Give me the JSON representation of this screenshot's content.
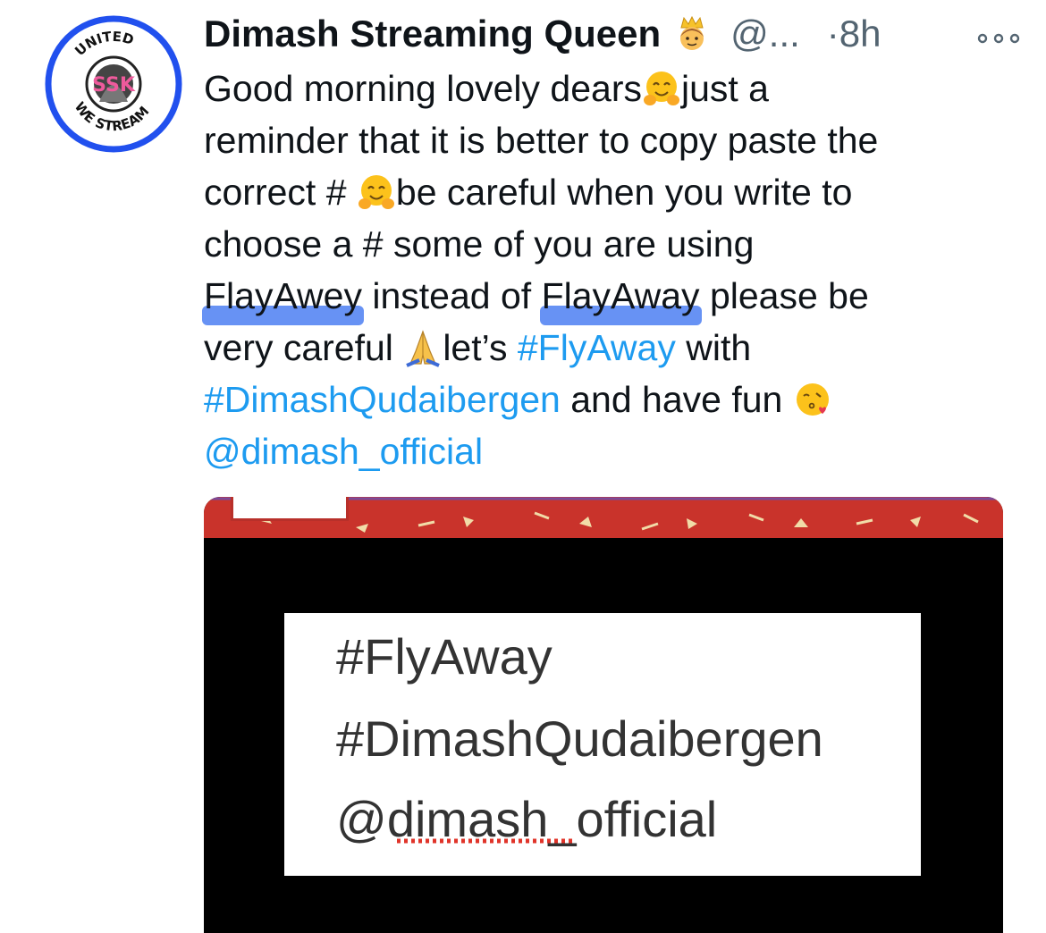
{
  "tweet": {
    "author": {
      "display_name": "Dimash Streaming Queen",
      "handle": "@...",
      "avatar_text_top": "UNITED",
      "avatar_text_center": "SSK",
      "avatar_text_bottom": "WE STREAM",
      "badge_icon": "crown-person-emoji"
    },
    "separator": "·",
    "time": "8h",
    "more_icon": "more-dots-icon",
    "text": {
      "l1_a": "Good morning lovely dears",
      "l1_b": "just a",
      "l2": "reminder that it is better to copy paste the",
      "l3_a": "correct # ",
      "l3_b": "be careful when you write to",
      "l4": "choose a #  some of you are using",
      "l5_a": "FlayAwey",
      "l5_b": " instead of ",
      "l5_c": "FlayAway",
      "l5_d": " please be",
      "l6_a": "very careful ",
      "l6_b": "let’s  ",
      "l6_c": "#FlyAway",
      "l6_d": " with",
      "l7_a": "#DimashQudaibergen",
      "l7_b": " and have fun ",
      "l8": "@dimash_official"
    },
    "media": {
      "lines": [
        "#FlyAway",
        "#DimashQudaibergen",
        "@dimash_official"
      ]
    },
    "colors": {
      "link": "#1d9bf0",
      "secondary": "#536471",
      "highlight": "#346ef0",
      "avatar_ring": "#1d4ff0"
    }
  }
}
